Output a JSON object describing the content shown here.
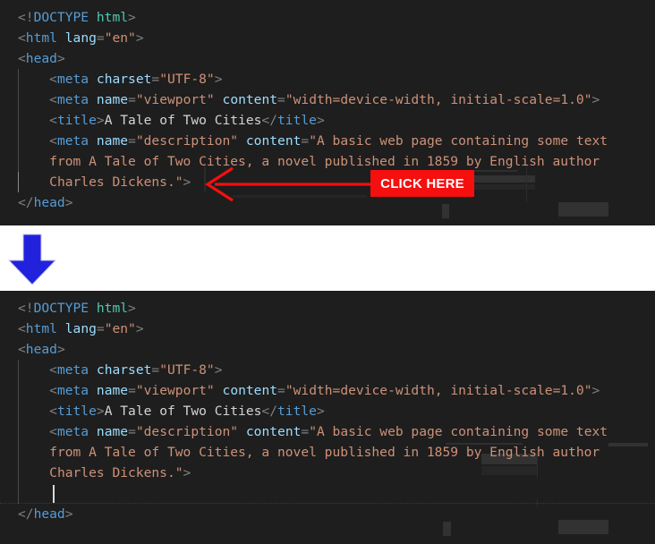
{
  "annotation": {
    "badge_label": "CLICK HERE",
    "badge_color": "#f50f0f",
    "badge_text_color": "#ffffff",
    "arrow_color": "#f50f0f",
    "step_arrow_color": "#2222dd",
    "step_arrow_direction": "down"
  },
  "editor": {
    "background": "#1e1e1e",
    "default_text_color": "#d4d4d4",
    "syntax_colors": {
      "punctuation": "#808080",
      "tag": "#569cd6",
      "doctype_value": "#4ec9b0",
      "attribute": "#9cdcfe",
      "string": "#ce9178",
      "text": "#d4d4d4"
    }
  },
  "panels": [
    {
      "id": "before",
      "caption": "code editor before click",
      "lines": [
        {
          "indent": 0,
          "tokens": [
            {
              "t": "pn",
              "v": "<!"
            },
            {
              "t": "tag",
              "v": "DOCTYPE"
            },
            {
              "t": "txt",
              "v": " "
            },
            {
              "t": "tag2",
              "v": "html"
            },
            {
              "t": "pn",
              "v": ">"
            }
          ]
        },
        {
          "indent": 0,
          "tokens": [
            {
              "t": "pn",
              "v": "<"
            },
            {
              "t": "tag",
              "v": "html"
            },
            {
              "t": "txt",
              "v": " "
            },
            {
              "t": "att",
              "v": "lang"
            },
            {
              "t": "pn",
              "v": "="
            },
            {
              "t": "str",
              "v": "\"en\""
            },
            {
              "t": "pn",
              "v": ">"
            }
          ]
        },
        {
          "indent": 0,
          "tokens": [
            {
              "t": "pn",
              "v": "<"
            },
            {
              "t": "tag",
              "v": "head"
            },
            {
              "t": "pn",
              "v": ">"
            }
          ]
        },
        {
          "indent": 1,
          "tokens": [
            {
              "t": "pn",
              "v": "<"
            },
            {
              "t": "tag",
              "v": "meta"
            },
            {
              "t": "txt",
              "v": " "
            },
            {
              "t": "att",
              "v": "charset"
            },
            {
              "t": "pn",
              "v": "="
            },
            {
              "t": "str",
              "v": "\"UTF-8\""
            },
            {
              "t": "pn",
              "v": ">"
            }
          ]
        },
        {
          "indent": 1,
          "tokens": [
            {
              "t": "pn",
              "v": "<"
            },
            {
              "t": "tag",
              "v": "meta"
            },
            {
              "t": "txt",
              "v": " "
            },
            {
              "t": "att",
              "v": "name"
            },
            {
              "t": "pn",
              "v": "="
            },
            {
              "t": "str",
              "v": "\"viewport\""
            },
            {
              "t": "txt",
              "v": " "
            },
            {
              "t": "att",
              "v": "content"
            },
            {
              "t": "pn",
              "v": "="
            },
            {
              "t": "str",
              "v": "\"width=device-width, initial-scale=1.0\""
            },
            {
              "t": "pn",
              "v": ">"
            }
          ]
        },
        {
          "indent": 1,
          "tokens": [
            {
              "t": "pn",
              "v": "<"
            },
            {
              "t": "tag",
              "v": "title"
            },
            {
              "t": "pn",
              "v": ">"
            },
            {
              "t": "txt",
              "v": "A Tale of Two Cities"
            },
            {
              "t": "pn",
              "v": "</"
            },
            {
              "t": "tag",
              "v": "title"
            },
            {
              "t": "pn",
              "v": ">"
            }
          ]
        },
        {
          "indent": 1,
          "tokens": [
            {
              "t": "pn",
              "v": "<"
            },
            {
              "t": "tag",
              "v": "meta"
            },
            {
              "t": "txt",
              "v": " "
            },
            {
              "t": "att",
              "v": "name"
            },
            {
              "t": "pn",
              "v": "="
            },
            {
              "t": "str",
              "v": "\"description\""
            },
            {
              "t": "txt",
              "v": " "
            },
            {
              "t": "att",
              "v": "content"
            },
            {
              "t": "pn",
              "v": "="
            },
            {
              "t": "str",
              "v": "\"A basic web page containing some text"
            }
          ]
        },
        {
          "indent": 1,
          "tokens": [
            {
              "t": "str",
              "v": "from A Tale of Two Cities, a novel published in 1859 by English author"
            }
          ]
        },
        {
          "indent": 1,
          "active": true,
          "tokens": [
            {
              "t": "str",
              "v": "Charles Dickens.\""
            },
            {
              "t": "pn",
              "v": ">"
            }
          ]
        },
        {
          "indent": 0,
          "tokens": [
            {
              "t": "pn",
              "v": "</"
            },
            {
              "t": "tag",
              "v": "head"
            },
            {
              "t": "pn",
              "v": ">"
            }
          ]
        }
      ]
    },
    {
      "id": "after",
      "caption": "code editor after click with new empty line",
      "lines": [
        {
          "indent": 0,
          "tokens": [
            {
              "t": "pn",
              "v": "<!"
            },
            {
              "t": "tag",
              "v": "DOCTYPE"
            },
            {
              "t": "txt",
              "v": " "
            },
            {
              "t": "tag2",
              "v": "html"
            },
            {
              "t": "pn",
              "v": ">"
            }
          ]
        },
        {
          "indent": 0,
          "tokens": [
            {
              "t": "pn",
              "v": "<"
            },
            {
              "t": "tag",
              "v": "html"
            },
            {
              "t": "txt",
              "v": " "
            },
            {
              "t": "att",
              "v": "lang"
            },
            {
              "t": "pn",
              "v": "="
            },
            {
              "t": "str",
              "v": "\"en\""
            },
            {
              "t": "pn",
              "v": ">"
            }
          ]
        },
        {
          "indent": 0,
          "tokens": [
            {
              "t": "pn",
              "v": "<"
            },
            {
              "t": "tag",
              "v": "head"
            },
            {
              "t": "pn",
              "v": ">"
            }
          ]
        },
        {
          "indent": 1,
          "tokens": [
            {
              "t": "pn",
              "v": "<"
            },
            {
              "t": "tag",
              "v": "meta"
            },
            {
              "t": "txt",
              "v": " "
            },
            {
              "t": "att",
              "v": "charset"
            },
            {
              "t": "pn",
              "v": "="
            },
            {
              "t": "str",
              "v": "\"UTF-8\""
            },
            {
              "t": "pn",
              "v": ">"
            }
          ]
        },
        {
          "indent": 1,
          "tokens": [
            {
              "t": "pn",
              "v": "<"
            },
            {
              "t": "tag",
              "v": "meta"
            },
            {
              "t": "txt",
              "v": " "
            },
            {
              "t": "att",
              "v": "name"
            },
            {
              "t": "pn",
              "v": "="
            },
            {
              "t": "str",
              "v": "\"viewport\""
            },
            {
              "t": "txt",
              "v": " "
            },
            {
              "t": "att",
              "v": "content"
            },
            {
              "t": "pn",
              "v": "="
            },
            {
              "t": "str",
              "v": "\"width=device-width, initial-scale=1.0\""
            },
            {
              "t": "pn",
              "v": ">"
            }
          ]
        },
        {
          "indent": 1,
          "tokens": [
            {
              "t": "pn",
              "v": "<"
            },
            {
              "t": "tag",
              "v": "title"
            },
            {
              "t": "pn",
              "v": ">"
            },
            {
              "t": "txt",
              "v": "A Tale of Two Cities"
            },
            {
              "t": "pn",
              "v": "</"
            },
            {
              "t": "tag",
              "v": "title"
            },
            {
              "t": "pn",
              "v": ">"
            }
          ]
        },
        {
          "indent": 1,
          "tokens": [
            {
              "t": "pn",
              "v": "<"
            },
            {
              "t": "tag",
              "v": "meta"
            },
            {
              "t": "txt",
              "v": " "
            },
            {
              "t": "att",
              "v": "name"
            },
            {
              "t": "pn",
              "v": "="
            },
            {
              "t": "str",
              "v": "\"description\""
            },
            {
              "t": "txt",
              "v": " "
            },
            {
              "t": "att",
              "v": "content"
            },
            {
              "t": "pn",
              "v": "="
            },
            {
              "t": "str",
              "v": "\"A basic web page containing some text"
            }
          ]
        },
        {
          "indent": 1,
          "tokens": [
            {
              "t": "str",
              "v": "from A Tale of Two Cities, a novel published in 1859 by English author"
            }
          ]
        },
        {
          "indent": 1,
          "tokens": [
            {
              "t": "str",
              "v": "Charles Dickens.\""
            },
            {
              "t": "pn",
              "v": ">"
            }
          ]
        },
        {
          "indent": 1,
          "caret": true,
          "tokens": []
        },
        {
          "indent": 0,
          "tokens": [
            {
              "t": "pn",
              "v": "</"
            },
            {
              "t": "tag",
              "v": "head"
            },
            {
              "t": "pn",
              "v": ">"
            }
          ]
        }
      ]
    }
  ]
}
